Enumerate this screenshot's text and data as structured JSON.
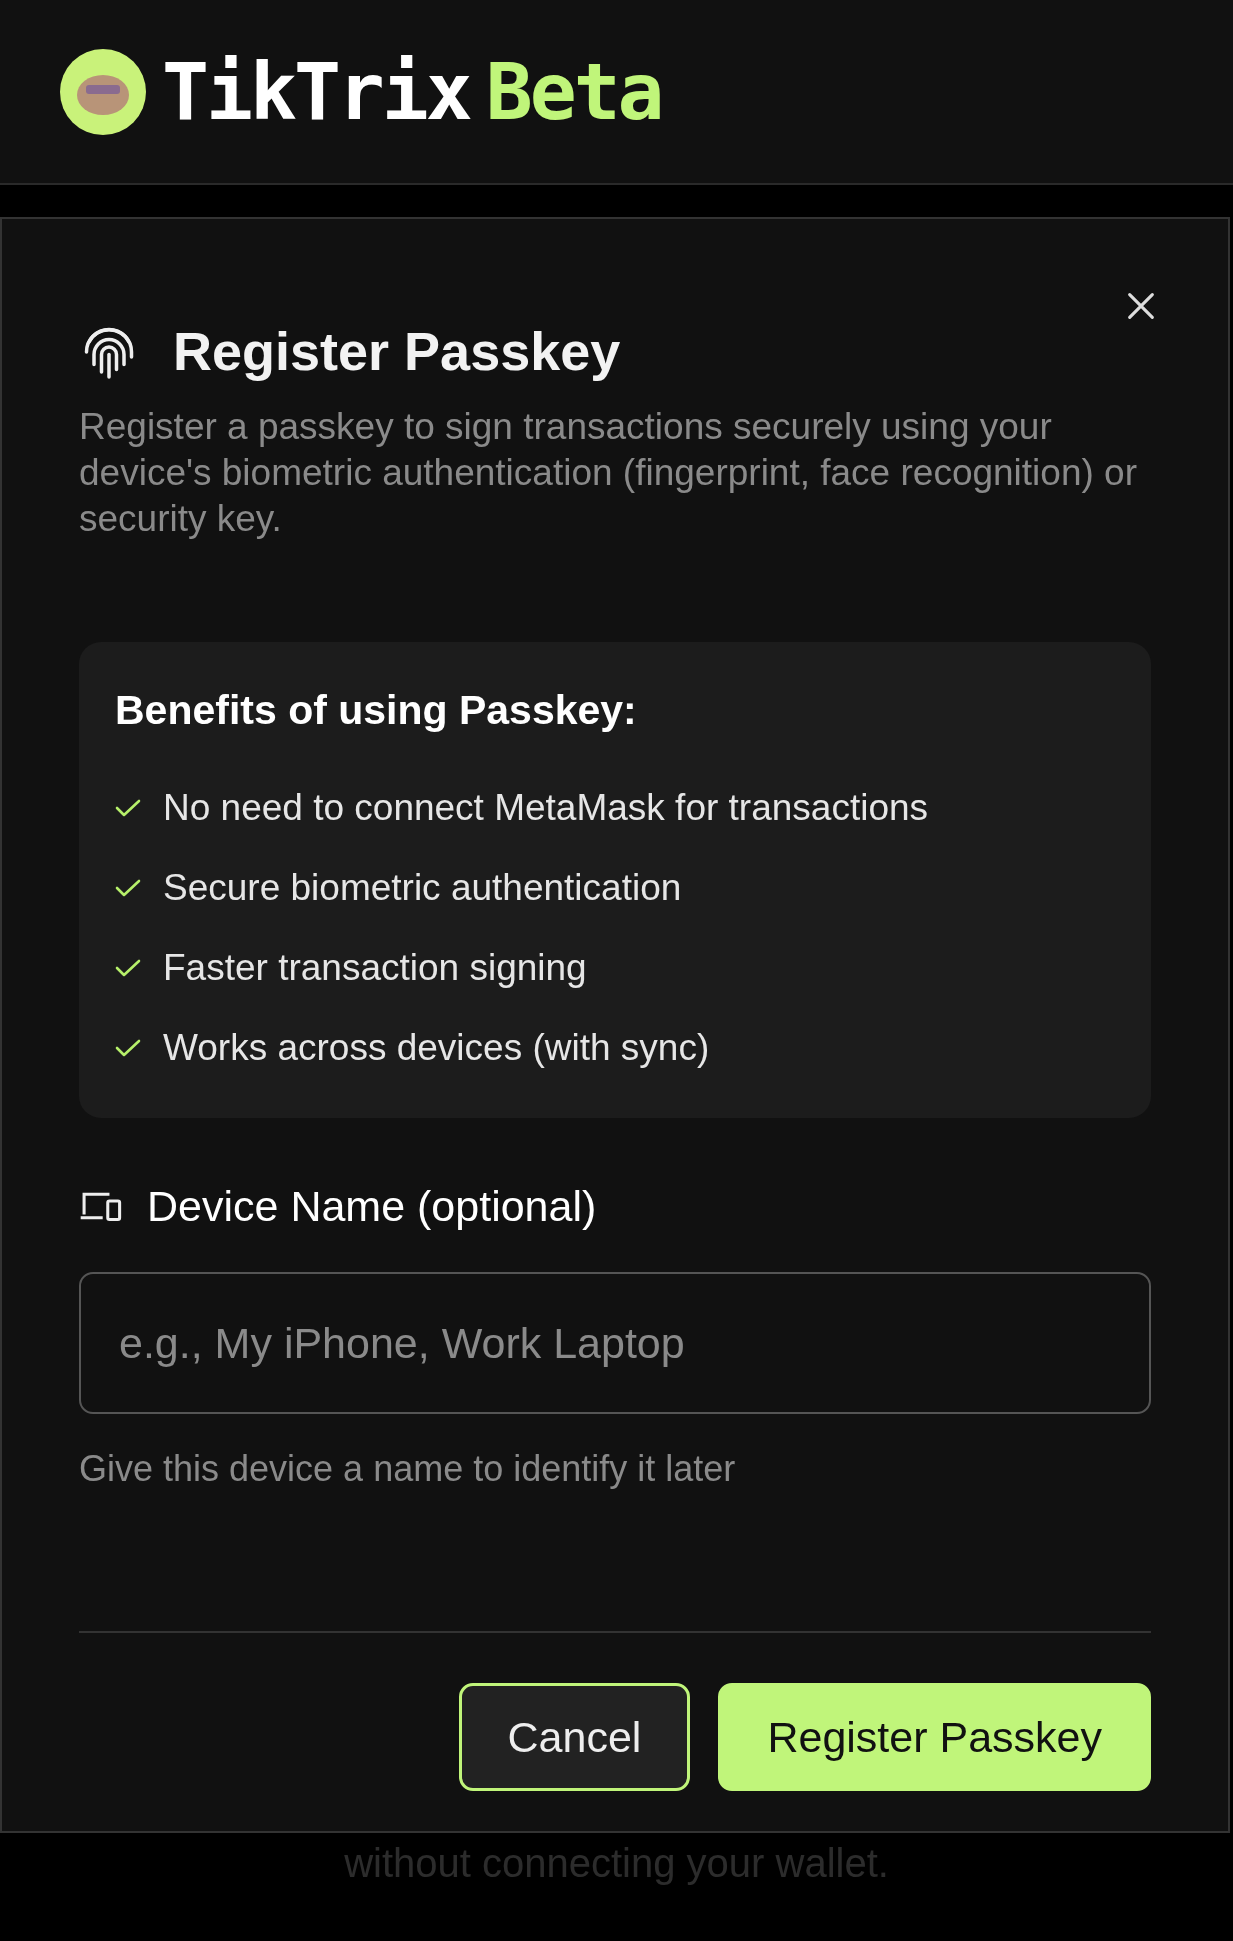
{
  "header": {
    "brand": "TikTrix",
    "badge": "Beta"
  },
  "background": {
    "text": "without connecting your wallet."
  },
  "dialog": {
    "title": "Register Passkey",
    "description": "Register a passkey to sign transactions securely using your device's biometric authentication (fingerprint, face recognition) or security key.",
    "benefits": {
      "title": "Benefits of using Passkey:",
      "items": [
        "No need to connect MetaMask for transactions",
        "Secure biometric authentication",
        "Faster transaction signing",
        "Works across devices (with sync)"
      ]
    },
    "device_name": {
      "label": "Device Name (optional)",
      "placeholder": "e.g., My iPhone, Work Laptop",
      "help": "Give this device a name to identify it later"
    },
    "buttons": [
      {
        "label": "Cancel",
        "kind": "secondary"
      },
      {
        "label": "Register Passkey",
        "kind": "primary"
      }
    ]
  }
}
